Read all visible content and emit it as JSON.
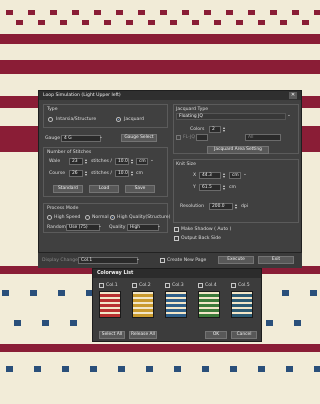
{
  "dialog": {
    "title": "Loop Simulation (Light Upper left)",
    "close_glyph": "✕"
  },
  "type_group": {
    "label": "Type",
    "options": [
      "Intarsia/Structure",
      "Jacquard"
    ],
    "selected": "Jacquard"
  },
  "gauge": {
    "label": "Gauge",
    "value": "4 G",
    "button": "Gauge Select"
  },
  "stitches": {
    "label": "Number of Stitches",
    "wale_label": "Wale",
    "wale_value": "23",
    "wale_unit": "stitches /",
    "wale_len": "10.0",
    "wale_len_unit": "cm",
    "course_label": "Course",
    "course_value": "26",
    "course_unit": "stitches /",
    "course_len": "10.0",
    "course_len_unit": "cm"
  },
  "action_buttons": [
    "Standard",
    "Load",
    "Save"
  ],
  "process": {
    "label": "Process Mode",
    "modes": [
      "High Speed",
      "Normal",
      "High Quality(Structure)"
    ],
    "selected": "High Quality(Structure)",
    "random_label": "Random",
    "random_value": "Use (75)",
    "quality_label": "Quality",
    "quality_value": "High"
  },
  "jacquard_type": {
    "label": "Jacquard Type",
    "value": "Floating JQ",
    "colors_label": "Colors",
    "colors_value": "2",
    "fl_label": "FL-JQ",
    "all_label": "All",
    "area_button": "Jacquard Area Setting"
  },
  "knit_size": {
    "label": "Knit Size",
    "x_label": "X",
    "x_value": "44.3",
    "x_unit": "cm",
    "y_label": "Y",
    "y_value": "61.5",
    "y_unit": "cm",
    "resolution_label": "Resolution",
    "resolution_value": "200.0",
    "resolution_unit": "dpi"
  },
  "options": {
    "make_shadow": "Make Shadow ( Auto )",
    "output_back": "Output Back Side",
    "create_new_page": "Create New Page"
  },
  "display_change": {
    "label": "Display Change",
    "value": "Col.1"
  },
  "footer_buttons": {
    "execute": "Execute",
    "exit": "Exit"
  },
  "colorway": {
    "title": "Colorway List",
    "items": [
      {
        "label": "Col.1",
        "color": "#b8302f"
      },
      {
        "label": "Col.2",
        "color": "#c99a2e"
      },
      {
        "label": "Col.3",
        "color": "#2f5f88"
      },
      {
        "label": "Col.4",
        "color": "#3c7a3a"
      },
      {
        "label": "Col.5",
        "color": "#2c5a72"
      }
    ],
    "select_all": "Select All",
    "release_all": "Release All",
    "ok": "OK",
    "cancel": "Cancel"
  },
  "colors": {
    "knit_red": "#8a1d36",
    "knit_cream": "#f1ebd7",
    "knit_blue": "#2a4f7a",
    "dialog_bg": "#404040",
    "accent": "#6aa9ff"
  }
}
